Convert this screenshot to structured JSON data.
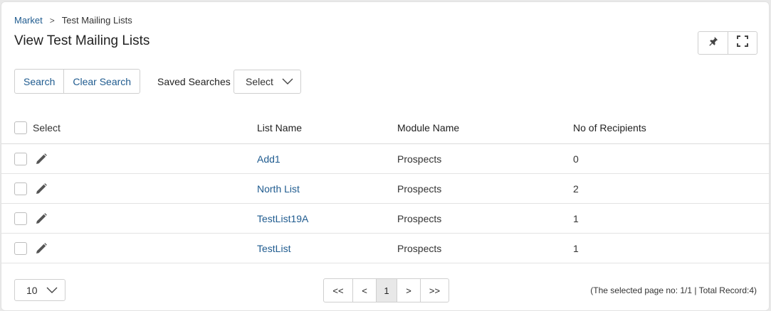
{
  "breadcrumb": {
    "parent": "Market",
    "separator": ">",
    "current": "Test Mailing Lists"
  },
  "page_title": "View Test Mailing Lists",
  "top_actions": {
    "pin_icon": "pin-icon",
    "fullscreen_icon": "fullscreen-icon"
  },
  "search": {
    "search_label": "Search",
    "clear_label": "Clear Search"
  },
  "saved_searches": {
    "label": "Saved Searches",
    "selected": "Select"
  },
  "table": {
    "headers": {
      "select": "Select",
      "list_name": "List Name",
      "module_name": "Module Name",
      "recipients": "No of Recipients"
    },
    "rows": [
      {
        "list_name": "Add1",
        "module_name": "Prospects",
        "recipients": "0"
      },
      {
        "list_name": "North List",
        "module_name": "Prospects",
        "recipients": "2"
      },
      {
        "list_name": "TestList19A",
        "module_name": "Prospects",
        "recipients": "1"
      },
      {
        "list_name": "TestList",
        "module_name": "Prospects",
        "recipients": "1"
      }
    ]
  },
  "footer": {
    "page_size": "10",
    "pager": {
      "first": "<<",
      "prev": "<",
      "current": "1",
      "next": ">",
      "last": ">>"
    },
    "page_info": "(The selected page no: 1/1 | Total Record:4)"
  },
  "colors": {
    "link": "#1f5b8f",
    "border": "#cfcfcf",
    "active_page_bg": "#e8e8e8"
  }
}
